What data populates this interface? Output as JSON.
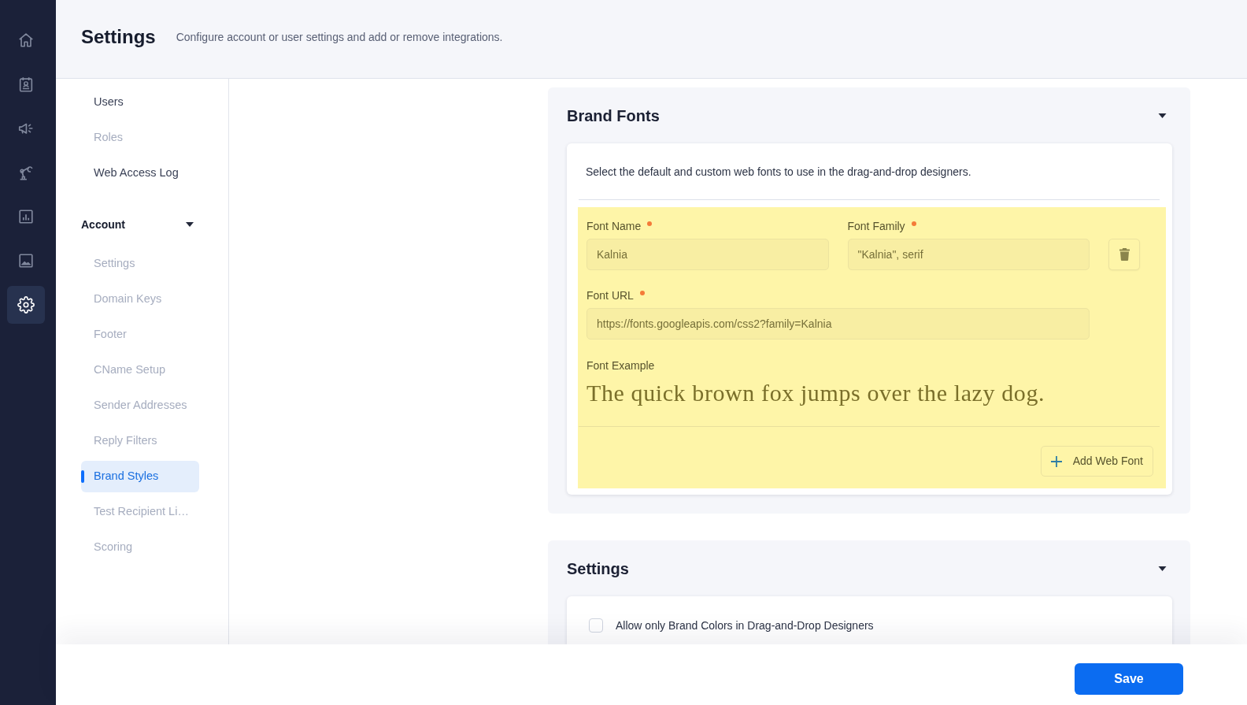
{
  "rail": {
    "items": [
      {
        "kind": "home",
        "selected": false
      },
      {
        "kind": "contacts",
        "selected": false
      },
      {
        "kind": "megaphone",
        "selected": false
      },
      {
        "kind": "robot-arm",
        "selected": false
      },
      {
        "kind": "chart",
        "selected": false
      },
      {
        "kind": "image",
        "selected": false
      },
      {
        "kind": "gear",
        "selected": true
      }
    ]
  },
  "header": {
    "title": "Settings",
    "subtitle": "Configure account or user settings and add or remove integrations."
  },
  "settings_nav": {
    "items": [
      {
        "label": "Users",
        "disabled": false,
        "selected": false
      },
      {
        "label": "Roles",
        "disabled": true,
        "selected": false
      },
      {
        "label": "Web Access Log",
        "disabled": false,
        "selected": false
      }
    ],
    "sections": [
      {
        "title": "Account",
        "expanded": true,
        "items": [
          {
            "label": "Settings",
            "disabled": true,
            "selected": false
          },
          {
            "label": "Domain Keys",
            "disabled": true,
            "selected": false
          },
          {
            "label": "Footer",
            "disabled": true,
            "selected": false
          },
          {
            "label": "CName Setup",
            "disabled": true,
            "selected": false
          },
          {
            "label": "Sender Addresses",
            "disabled": true,
            "selected": false
          },
          {
            "label": "Reply Filters",
            "disabled": true,
            "selected": false
          },
          {
            "label": "Brand Styles",
            "disabled": false,
            "selected": true
          },
          {
            "label": "Test Recipient Li…",
            "disabled": true,
            "selected": false
          },
          {
            "label": "Scoring",
            "disabled": true,
            "selected": false
          }
        ]
      }
    ]
  },
  "brand_fonts": {
    "title": "Brand Fonts",
    "expanded": true,
    "description": "Select the default and custom web fonts to use in the drag-and-drop designers.",
    "fonts": [
      {
        "highlighted": true,
        "name": {
          "label": "Font Name",
          "required": true,
          "value": "Kalnia"
        },
        "family": {
          "label": "Font Family",
          "required": true,
          "value": "\"Kalnia\", serif"
        },
        "url": {
          "label": "Font URL",
          "required": true,
          "value": "https://fonts.googleapis.com/css2?family=Kalnia"
        },
        "example_label": "Font Example",
        "example": "The quick brown fox jumps over the lazy dog."
      }
    ],
    "add_button": "Add Web Font"
  },
  "settings_panel": {
    "title": "Settings",
    "expanded": true,
    "options": [
      {
        "label": "Allow only Brand Colors in Drag-and-Drop Designers",
        "checked": false
      }
    ]
  },
  "footer": {
    "save_button": "Save"
  }
}
